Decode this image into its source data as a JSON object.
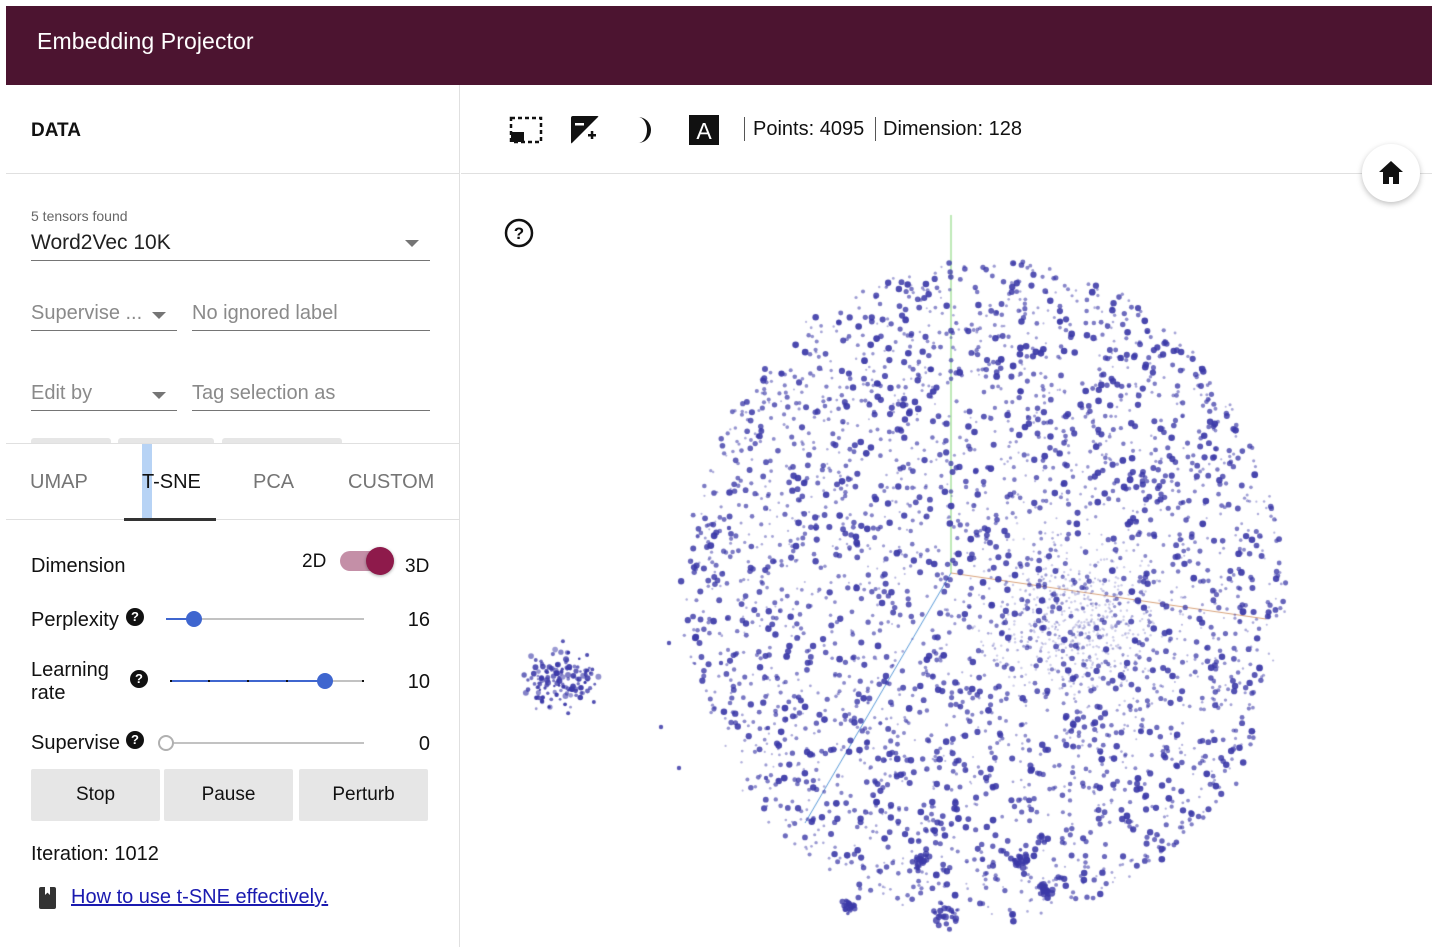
{
  "header": {
    "title": "Embedding Projector"
  },
  "data_panel": {
    "section_title": "DATA",
    "tensors_caption": "5 tensors found",
    "tensor_selected": "Word2Vec 10K",
    "supervise_select": "Supervise ...",
    "ignored_label_placeholder": "No ignored label",
    "edit_by_select": "Edit by",
    "tag_selection_placeholder": "Tag selection as"
  },
  "tabs": [
    {
      "label": "UMAP",
      "active": false
    },
    {
      "label": "T-SNE",
      "active": true
    },
    {
      "label": "PCA",
      "active": false
    },
    {
      "label": "CUSTOM",
      "active": false
    }
  ],
  "tsne": {
    "dimension": {
      "label": "Dimension",
      "option_2d": "2D",
      "option_3d": "3D",
      "selected": "3D"
    },
    "perplexity": {
      "label": "Perplexity",
      "help": "?",
      "value": "16",
      "fraction": 0.14
    },
    "learning_rate": {
      "label_line1": "Learning",
      "label_line2": "rate",
      "help": "?",
      "value": "10",
      "fraction": 0.8
    },
    "supervise": {
      "label": "Supervise",
      "help": "?",
      "value": "0",
      "fraction": 0.0
    },
    "buttons": {
      "stop": "Stop",
      "pause": "Pause",
      "perturb": "Perturb"
    },
    "iteration": "Iteration: 1012",
    "link": "How to use t-SNE effectively."
  },
  "toolbar": {
    "icons": [
      "selection-box-icon",
      "night-mode-icon",
      "moon-icon",
      "label-icon"
    ],
    "label_icon_text": "A",
    "points": "Points: 4095",
    "dimension": "Dimension: 128"
  },
  "projection": {
    "help": "?",
    "point_color": "#3c3aa8",
    "axis_colors": {
      "y": "#7fd36e",
      "x": "#d8a27a",
      "z": "#5a9ad8"
    }
  },
  "colors": {
    "header": "#4c1430",
    "toggle": "#8e1a4b",
    "slider": "#3f66cf"
  }
}
